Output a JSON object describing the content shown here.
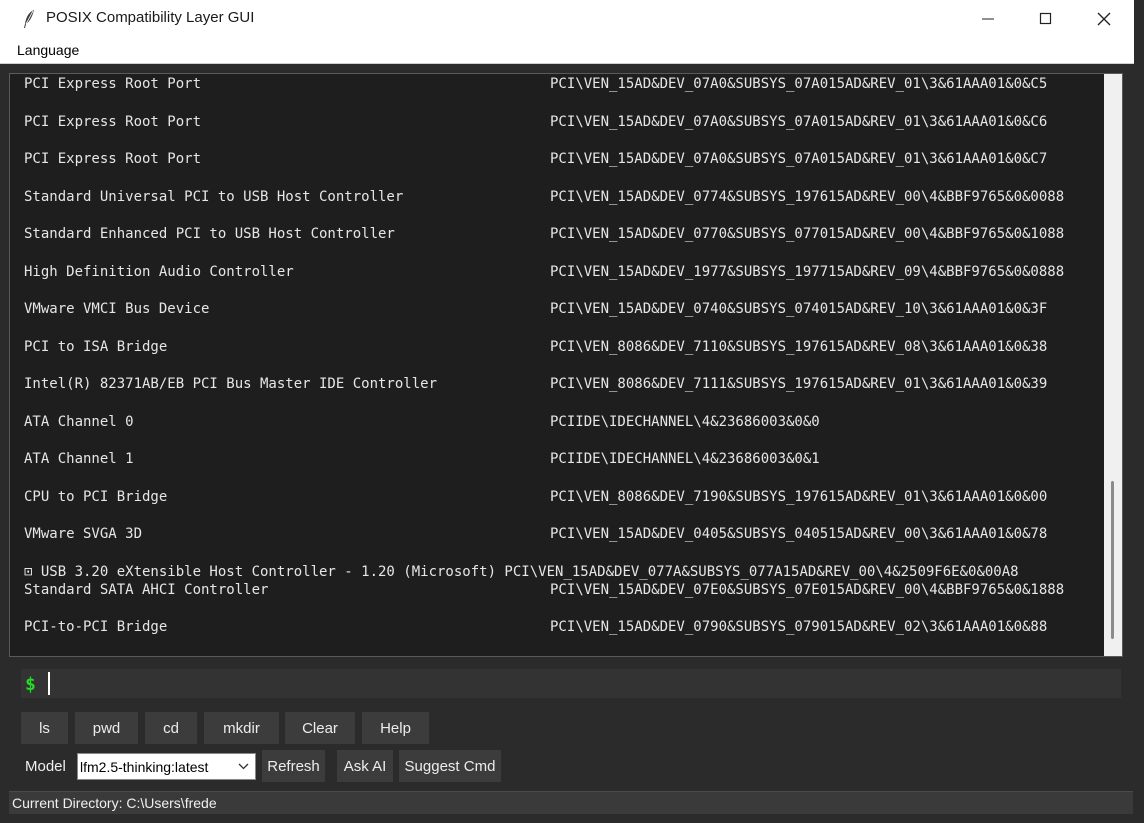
{
  "window": {
    "title": "POSIX Compatibility Layer GUI",
    "app_icon": "feather-icon"
  },
  "menu": {
    "items": [
      {
        "label": "Language"
      }
    ]
  },
  "output": {
    "rows": [
      {
        "name": "PCI Express Root Port",
        "id": "PCI\\VEN_15AD&DEV_07A0&SUBSYS_07A015AD&REV_01\\3&61AAA01&0&C5"
      },
      {
        "name": "PCI Express Root Port",
        "id": "PCI\\VEN_15AD&DEV_07A0&SUBSYS_07A015AD&REV_01\\3&61AAA01&0&C6"
      },
      {
        "name": "PCI Express Root Port",
        "id": "PCI\\VEN_15AD&DEV_07A0&SUBSYS_07A015AD&REV_01\\3&61AAA01&0&C7"
      },
      {
        "name": "Standard Universal PCI to USB Host Controller",
        "id": "PCI\\VEN_15AD&DEV_0774&SUBSYS_197615AD&REV_00\\4&BBF9765&0&0088"
      },
      {
        "name": "Standard Enhanced PCI to USB Host Controller",
        "id": "PCI\\VEN_15AD&DEV_0770&SUBSYS_077015AD&REV_00\\4&BBF9765&0&1088"
      },
      {
        "name": "High Definition Audio Controller",
        "id": "PCI\\VEN_15AD&DEV_1977&SUBSYS_197715AD&REV_09\\4&BBF9765&0&0888"
      },
      {
        "name": "VMware VMCI Bus Device",
        "id": "PCI\\VEN_15AD&DEV_0740&SUBSYS_074015AD&REV_10\\3&61AAA01&0&3F"
      },
      {
        "name": "PCI to ISA Bridge",
        "id": "PCI\\VEN_8086&DEV_7110&SUBSYS_197615AD&REV_08\\3&61AAA01&0&38"
      },
      {
        "name": "Intel(R) 82371AB/EB PCI Bus Master IDE Controller",
        "id": "PCI\\VEN_8086&DEV_7111&SUBSYS_197615AD&REV_01\\3&61AAA01&0&39"
      },
      {
        "name": "ATA Channel 0",
        "id": "PCIIDE\\IDECHANNEL\\4&23686003&0&0"
      },
      {
        "name": "ATA Channel 1",
        "id": "PCIIDE\\IDECHANNEL\\4&23686003&0&1"
      },
      {
        "name": "CPU to PCI Bridge",
        "id": "PCI\\VEN_8086&DEV_7190&SUBSYS_197615AD&REV_01\\3&61AAA01&0&00"
      },
      {
        "name": "VMware SVGA 3D",
        "id": "PCI\\VEN_15AD&DEV_0405&SUBSYS_040515AD&REV_00\\3&61AAA01&0&78"
      }
    ],
    "overflow_line": "⊡ USB 3.20 eXtensible Host Controller - 1.20 (Microsoft) PCI\\VEN_15AD&DEV_077A&SUBSYS_077A15AD&REV_00\\4&2509F6E&0&00A8",
    "rows_after": [
      {
        "name": "Standard SATA AHCI Controller",
        "id": "PCI\\VEN_15AD&DEV_07E0&SUBSYS_07E015AD&REV_00\\4&BBF9765&0&1888"
      },
      {
        "name": "PCI-to-PCI Bridge",
        "id": "PCI\\VEN_15AD&DEV_0790&SUBSYS_079015AD&REV_02\\3&61AAA01&0&88"
      }
    ]
  },
  "command": {
    "prompt": "$",
    "value": ""
  },
  "toolbar": {
    "buttons": [
      {
        "label": "ls"
      },
      {
        "label": "pwd"
      },
      {
        "label": "cd"
      },
      {
        "label": "mkdir"
      },
      {
        "label": "Clear"
      },
      {
        "label": "Help"
      }
    ]
  },
  "model_bar": {
    "label": "Model",
    "selected": "lfm2.5-thinking:latest",
    "refresh_label": "Refresh",
    "ask_ai_label": "Ask AI",
    "suggest_label": "Suggest Cmd"
  },
  "status": {
    "text": "Current Directory: C:\\Users\\frede"
  },
  "colors": {
    "background": "#2b2b2b",
    "output_bg": "#1e1e1e",
    "prompt": "#22dd22",
    "button_bg": "#3c3c3c"
  }
}
